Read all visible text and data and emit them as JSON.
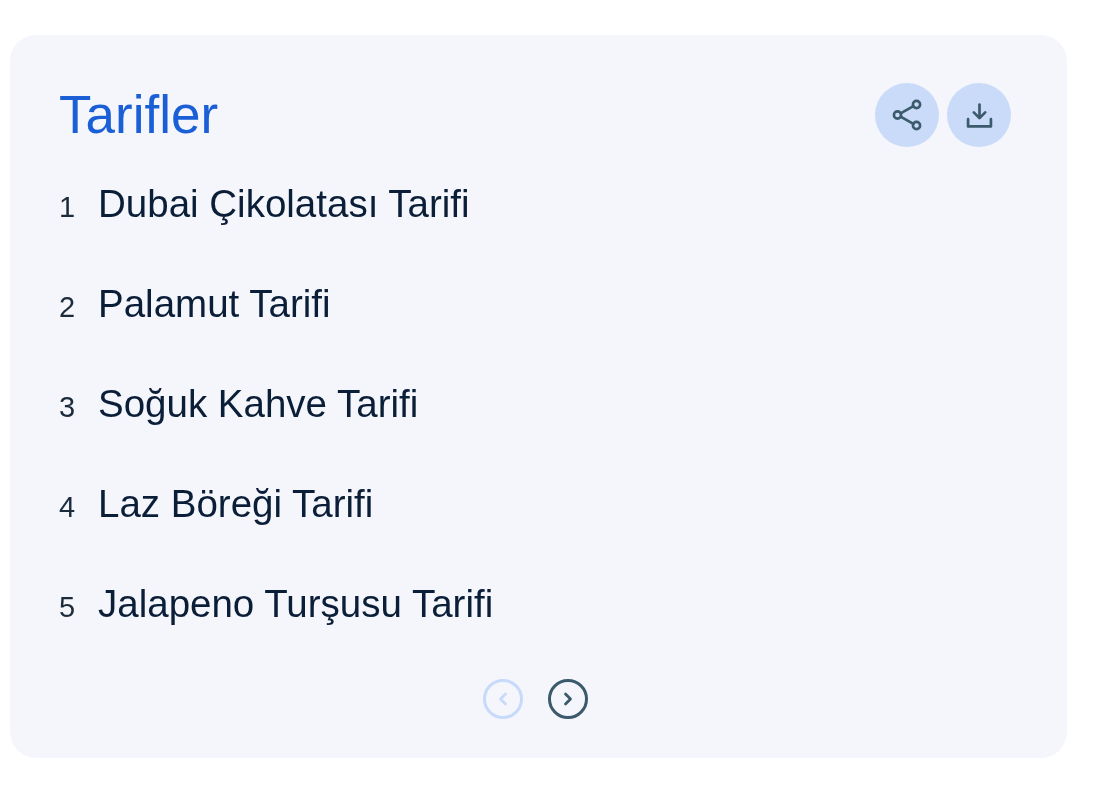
{
  "card": {
    "title": "Tarifler",
    "actions": [
      {
        "kind": "share"
      },
      {
        "kind": "download"
      }
    ],
    "items": [
      {
        "number": "1",
        "title": "Dubai Çikolatası Tarifi"
      },
      {
        "number": "2",
        "title": "Palamut Tarifi"
      },
      {
        "number": "3",
        "title": "Soğuk Kahve Tarifi"
      },
      {
        "number": "4",
        "title": "Laz Böreği Tarifi"
      },
      {
        "number": "5",
        "title": "Jalapeno Turşusu Tarifi"
      }
    ],
    "pagination": [
      {
        "kind": "previous",
        "disabled": true
      },
      {
        "kind": "next",
        "disabled": false
      }
    ]
  }
}
